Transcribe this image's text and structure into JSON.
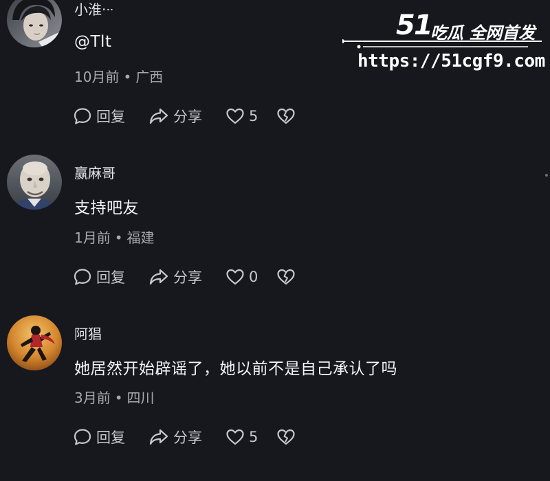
{
  "watermark": {
    "brand_number": "51",
    "brand_tag": "吃瓜 全网首发",
    "url": "https://51cgf9.com"
  },
  "actions": {
    "reply_label": "回复",
    "share_label": "分享"
  },
  "comments": [
    {
      "username": "小淮·ᐧᐧ",
      "content": "@Tlt",
      "time": "10月前",
      "location": "广西",
      "likes": "5"
    },
    {
      "username": "赢麻哥",
      "content": "支持吧友",
      "time": "1月前",
      "location": "福建",
      "likes": "0"
    },
    {
      "username": "阿猖",
      "content": "她居然开始辟谣了，她以前不是自己承认了吗",
      "time": "3月前",
      "location": "四川",
      "likes": "5"
    }
  ]
}
